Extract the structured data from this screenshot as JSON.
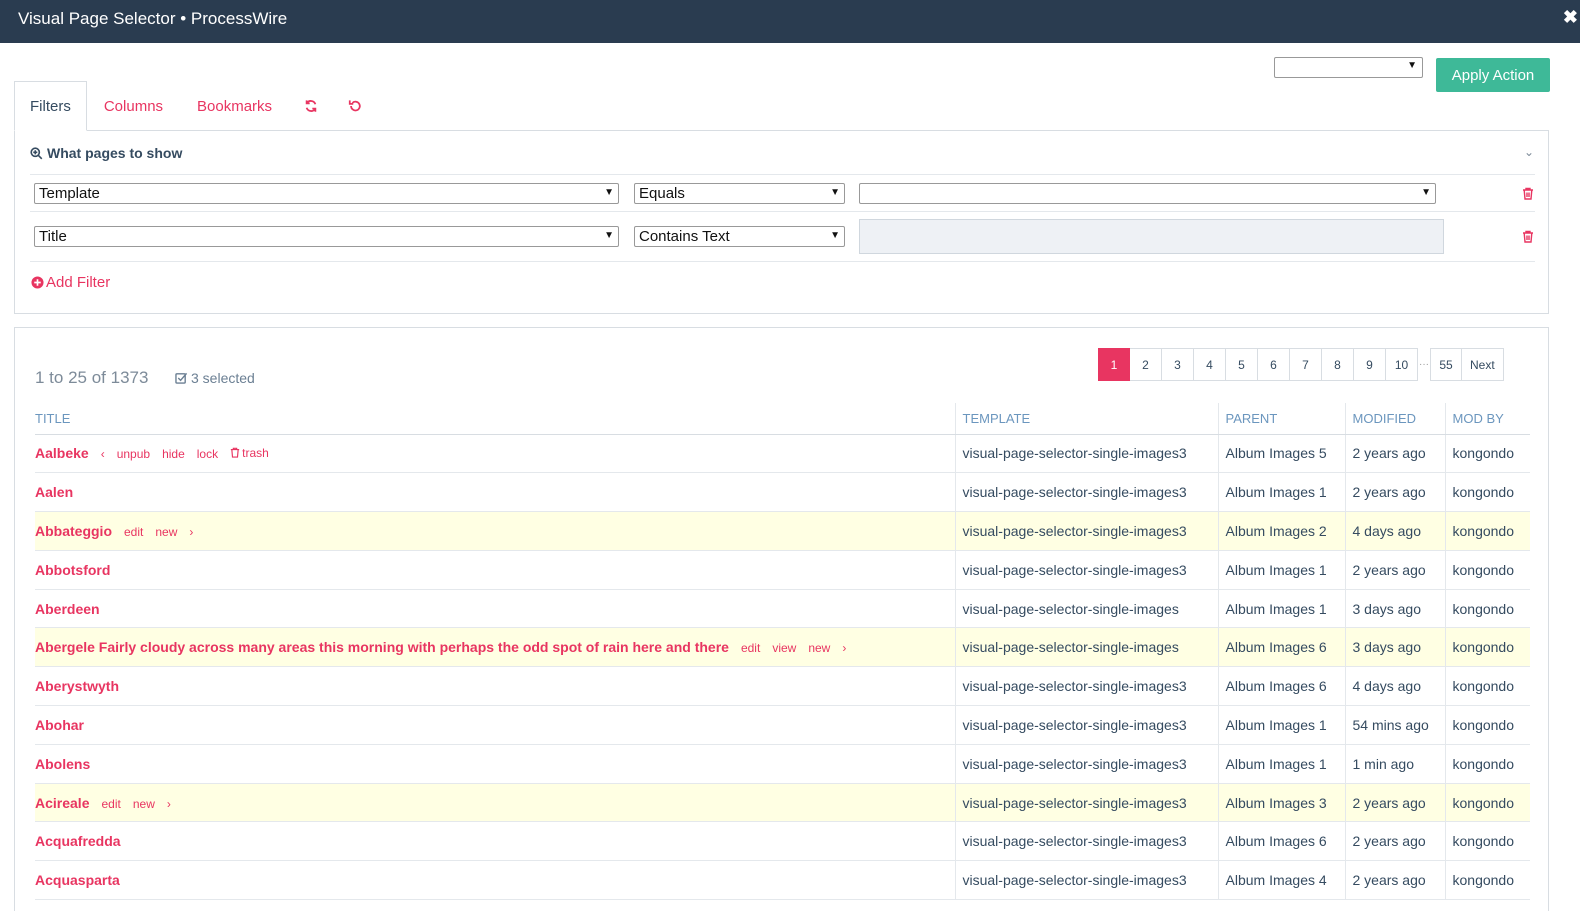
{
  "window": {
    "title": "Visual Page Selector • ProcessWire",
    "close_glyph": "✖"
  },
  "actions": {
    "select_value": "",
    "apply_label": "Apply Action"
  },
  "tabs": [
    {
      "label": "Filters"
    },
    {
      "label": "Columns"
    },
    {
      "label": "Bookmarks"
    }
  ],
  "filters": {
    "header": "What pages to show",
    "rows": [
      {
        "field": "Template",
        "operator": "Equals",
        "value": ""
      },
      {
        "field": "Title",
        "operator": "Contains Text",
        "value": ""
      }
    ],
    "add_label": "Add Filter"
  },
  "results": {
    "count": "1 to 25 of 1373",
    "selected": "3 selected",
    "pagination": {
      "pages": [
        "1",
        "2",
        "3",
        "4",
        "5",
        "6",
        "7",
        "8",
        "9",
        "10"
      ],
      "gap": "···",
      "last": "55",
      "next": "Next",
      "current": "1"
    },
    "columns": [
      "Title",
      "Template",
      "Parent",
      "Modified",
      "Mod By"
    ],
    "rows": [
      {
        "title": "Aalbeke",
        "actions": [
          "‹",
          "unpub",
          "hide",
          "lock",
          "trash"
        ],
        "template": "visual-page-selector-single-images3",
        "parent": "Album Images 5",
        "modified": "2 years ago",
        "mod_by": "kongondo",
        "highlight": false
      },
      {
        "title": "Aalen",
        "actions": [],
        "template": "visual-page-selector-single-images3",
        "parent": "Album Images 1",
        "modified": "2 years ago",
        "mod_by": "kongondo",
        "highlight": false
      },
      {
        "title": "Abbateggio",
        "actions": [
          "edit",
          "new",
          "›"
        ],
        "template": "visual-page-selector-single-images3",
        "parent": "Album Images 2",
        "modified": "4 days ago",
        "mod_by": "kongondo",
        "highlight": true
      },
      {
        "title": "Abbotsford",
        "actions": [],
        "template": "visual-page-selector-single-images3",
        "parent": "Album Images 1",
        "modified": "2 years ago",
        "mod_by": "kongondo",
        "highlight": false
      },
      {
        "title": "Aberdeen",
        "actions": [],
        "template": "visual-page-selector-single-images",
        "parent": "Album Images 1",
        "modified": "3 days ago",
        "mod_by": "kongondo",
        "highlight": false
      },
      {
        "title": "Abergele Fairly cloudy across many areas this morning with perhaps the odd spot of rain here and there",
        "actions": [
          "edit",
          "view",
          "new",
          "›"
        ],
        "template": "visual-page-selector-single-images",
        "parent": "Album Images 6",
        "modified": "3 days ago",
        "mod_by": "kongondo",
        "highlight": true
      },
      {
        "title": "Aberystwyth",
        "actions": [],
        "template": "visual-page-selector-single-images3",
        "parent": "Album Images 6",
        "modified": "4 days ago",
        "mod_by": "kongondo",
        "highlight": false
      },
      {
        "title": "Abohar",
        "actions": [],
        "template": "visual-page-selector-single-images3",
        "parent": "Album Images 1",
        "modified": "54 mins ago",
        "mod_by": "kongondo",
        "highlight": false
      },
      {
        "title": "Abolens",
        "actions": [],
        "template": "visual-page-selector-single-images3",
        "parent": "Album Images 1",
        "modified": "1 min ago",
        "mod_by": "kongondo",
        "highlight": false
      },
      {
        "title": "Acireale",
        "actions": [
          "edit",
          "new",
          "›"
        ],
        "template": "visual-page-selector-single-images3",
        "parent": "Album Images 3",
        "modified": "2 years ago",
        "mod_by": "kongondo",
        "highlight": true
      },
      {
        "title": "Acquafredda",
        "actions": [],
        "template": "visual-page-selector-single-images3",
        "parent": "Album Images 6",
        "modified": "2 years ago",
        "mod_by": "kongondo",
        "highlight": false
      },
      {
        "title": "Acquasparta",
        "actions": [],
        "template": "visual-page-selector-single-images3",
        "parent": "Album Images 4",
        "modified": "2 years ago",
        "mod_by": "kongondo",
        "highlight": false
      }
    ]
  },
  "colors": {
    "titlebar": "#2a3c50",
    "accent": "#e83561",
    "apply": "#3eb998",
    "highlight_row": "#ffffe3",
    "header_text": "#6b96be"
  }
}
